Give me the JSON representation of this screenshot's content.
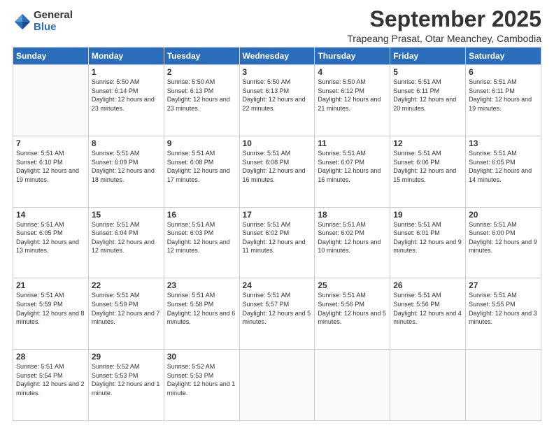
{
  "logo": {
    "general": "General",
    "blue": "Blue"
  },
  "title": {
    "month": "September 2025",
    "location": "Trapeang Prasat, Otar Meanchey, Cambodia"
  },
  "headers": [
    "Sunday",
    "Monday",
    "Tuesday",
    "Wednesday",
    "Thursday",
    "Friday",
    "Saturday"
  ],
  "weeks": [
    [
      {
        "day": "",
        "sunrise": "",
        "sunset": "",
        "daylight": ""
      },
      {
        "day": "1",
        "sunrise": "Sunrise: 5:50 AM",
        "sunset": "Sunset: 6:14 PM",
        "daylight": "Daylight: 12 hours and 23 minutes."
      },
      {
        "day": "2",
        "sunrise": "Sunrise: 5:50 AM",
        "sunset": "Sunset: 6:13 PM",
        "daylight": "Daylight: 12 hours and 23 minutes."
      },
      {
        "day": "3",
        "sunrise": "Sunrise: 5:50 AM",
        "sunset": "Sunset: 6:13 PM",
        "daylight": "Daylight: 12 hours and 22 minutes."
      },
      {
        "day": "4",
        "sunrise": "Sunrise: 5:50 AM",
        "sunset": "Sunset: 6:12 PM",
        "daylight": "Daylight: 12 hours and 21 minutes."
      },
      {
        "day": "5",
        "sunrise": "Sunrise: 5:51 AM",
        "sunset": "Sunset: 6:11 PM",
        "daylight": "Daylight: 12 hours and 20 minutes."
      },
      {
        "day": "6",
        "sunrise": "Sunrise: 5:51 AM",
        "sunset": "Sunset: 6:11 PM",
        "daylight": "Daylight: 12 hours and 19 minutes."
      }
    ],
    [
      {
        "day": "7",
        "sunrise": "Sunrise: 5:51 AM",
        "sunset": "Sunset: 6:10 PM",
        "daylight": "Daylight: 12 hours and 19 minutes."
      },
      {
        "day": "8",
        "sunrise": "Sunrise: 5:51 AM",
        "sunset": "Sunset: 6:09 PM",
        "daylight": "Daylight: 12 hours and 18 minutes."
      },
      {
        "day": "9",
        "sunrise": "Sunrise: 5:51 AM",
        "sunset": "Sunset: 6:08 PM",
        "daylight": "Daylight: 12 hours and 17 minutes."
      },
      {
        "day": "10",
        "sunrise": "Sunrise: 5:51 AM",
        "sunset": "Sunset: 6:08 PM",
        "daylight": "Daylight: 12 hours and 16 minutes."
      },
      {
        "day": "11",
        "sunrise": "Sunrise: 5:51 AM",
        "sunset": "Sunset: 6:07 PM",
        "daylight": "Daylight: 12 hours and 16 minutes."
      },
      {
        "day": "12",
        "sunrise": "Sunrise: 5:51 AM",
        "sunset": "Sunset: 6:06 PM",
        "daylight": "Daylight: 12 hours and 15 minutes."
      },
      {
        "day": "13",
        "sunrise": "Sunrise: 5:51 AM",
        "sunset": "Sunset: 6:05 PM",
        "daylight": "Daylight: 12 hours and 14 minutes."
      }
    ],
    [
      {
        "day": "14",
        "sunrise": "Sunrise: 5:51 AM",
        "sunset": "Sunset: 6:05 PM",
        "daylight": "Daylight: 12 hours and 13 minutes."
      },
      {
        "day": "15",
        "sunrise": "Sunrise: 5:51 AM",
        "sunset": "Sunset: 6:04 PM",
        "daylight": "Daylight: 12 hours and 12 minutes."
      },
      {
        "day": "16",
        "sunrise": "Sunrise: 5:51 AM",
        "sunset": "Sunset: 6:03 PM",
        "daylight": "Daylight: 12 hours and 12 minutes."
      },
      {
        "day": "17",
        "sunrise": "Sunrise: 5:51 AM",
        "sunset": "Sunset: 6:02 PM",
        "daylight": "Daylight: 12 hours and 11 minutes."
      },
      {
        "day": "18",
        "sunrise": "Sunrise: 5:51 AM",
        "sunset": "Sunset: 6:02 PM",
        "daylight": "Daylight: 12 hours and 10 minutes."
      },
      {
        "day": "19",
        "sunrise": "Sunrise: 5:51 AM",
        "sunset": "Sunset: 6:01 PM",
        "daylight": "Daylight: 12 hours and 9 minutes."
      },
      {
        "day": "20",
        "sunrise": "Sunrise: 5:51 AM",
        "sunset": "Sunset: 6:00 PM",
        "daylight": "Daylight: 12 hours and 9 minutes."
      }
    ],
    [
      {
        "day": "21",
        "sunrise": "Sunrise: 5:51 AM",
        "sunset": "Sunset: 5:59 PM",
        "daylight": "Daylight: 12 hours and 8 minutes."
      },
      {
        "day": "22",
        "sunrise": "Sunrise: 5:51 AM",
        "sunset": "Sunset: 5:59 PM",
        "daylight": "Daylight: 12 hours and 7 minutes."
      },
      {
        "day": "23",
        "sunrise": "Sunrise: 5:51 AM",
        "sunset": "Sunset: 5:58 PM",
        "daylight": "Daylight: 12 hours and 6 minutes."
      },
      {
        "day": "24",
        "sunrise": "Sunrise: 5:51 AM",
        "sunset": "Sunset: 5:57 PM",
        "daylight": "Daylight: 12 hours and 5 minutes."
      },
      {
        "day": "25",
        "sunrise": "Sunrise: 5:51 AM",
        "sunset": "Sunset: 5:56 PM",
        "daylight": "Daylight: 12 hours and 5 minutes."
      },
      {
        "day": "26",
        "sunrise": "Sunrise: 5:51 AM",
        "sunset": "Sunset: 5:56 PM",
        "daylight": "Daylight: 12 hours and 4 minutes."
      },
      {
        "day": "27",
        "sunrise": "Sunrise: 5:51 AM",
        "sunset": "Sunset: 5:55 PM",
        "daylight": "Daylight: 12 hours and 3 minutes."
      }
    ],
    [
      {
        "day": "28",
        "sunrise": "Sunrise: 5:51 AM",
        "sunset": "Sunset: 5:54 PM",
        "daylight": "Daylight: 12 hours and 2 minutes."
      },
      {
        "day": "29",
        "sunrise": "Sunrise: 5:52 AM",
        "sunset": "Sunset: 5:53 PM",
        "daylight": "Daylight: 12 hours and 1 minute."
      },
      {
        "day": "30",
        "sunrise": "Sunrise: 5:52 AM",
        "sunset": "Sunset: 5:53 PM",
        "daylight": "Daylight: 12 hours and 1 minute."
      },
      {
        "day": "",
        "sunrise": "",
        "sunset": "",
        "daylight": ""
      },
      {
        "day": "",
        "sunrise": "",
        "sunset": "",
        "daylight": ""
      },
      {
        "day": "",
        "sunrise": "",
        "sunset": "",
        "daylight": ""
      },
      {
        "day": "",
        "sunrise": "",
        "sunset": "",
        "daylight": ""
      }
    ]
  ]
}
